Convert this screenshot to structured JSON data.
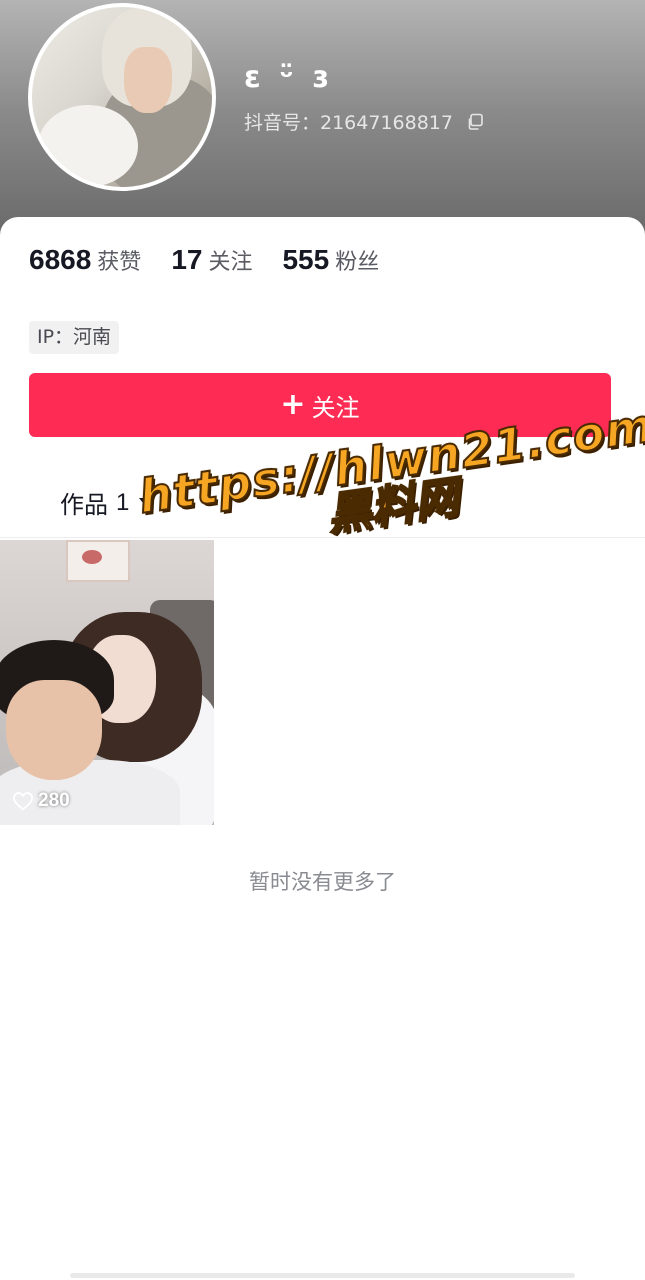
{
  "profile": {
    "username": "ε ᵕ̈ ɜ",
    "douyin_id": "抖音号：21647168817",
    "copy_icon": "copy-icon"
  },
  "stats": [
    {
      "value": "6868",
      "label": "获赞"
    },
    {
      "value": "17",
      "label": "关注"
    },
    {
      "value": "555",
      "label": "粉丝"
    }
  ],
  "ip_location": "IP：河南",
  "follow_button": {
    "icon": "+",
    "label": "关注"
  },
  "works_tab": {
    "label": "作品",
    "count": "1"
  },
  "videos": [
    {
      "likes": "280"
    }
  ],
  "end_message": "暂时没有更多了",
  "watermark": {
    "url": "https://hlwn21.com",
    "text": "黑料网"
  },
  "colors": {
    "accent": "#fe2c55",
    "watermark": "#f6a623"
  }
}
